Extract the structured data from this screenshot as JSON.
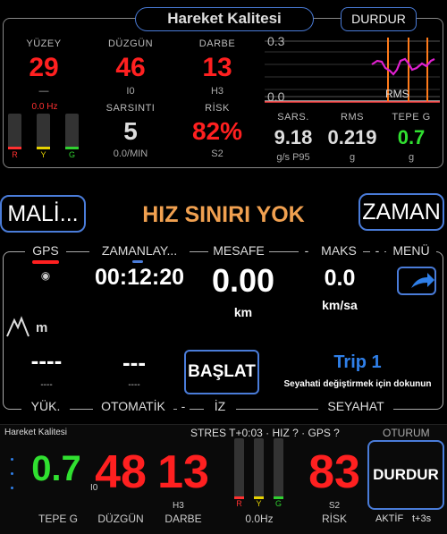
{
  "header": {
    "title": "Hareket Kalitesi",
    "stop_label": "DURDUR"
  },
  "metrics": [
    {
      "label": "YÜZEY",
      "value": "29",
      "sub": "—",
      "color": "#ff2020"
    },
    {
      "label": "DÜZGÜN",
      "value": "46",
      "sub": "I0",
      "color": "#ff2020"
    },
    {
      "label": "DARBE",
      "value": "13",
      "sub": "H3",
      "color": "#ff2020"
    }
  ],
  "metrics_row2": [
    {
      "label": "SARSINTI",
      "value": "5",
      "sub": "0.0/MIN",
      "color": "#dddddd"
    },
    {
      "label": "RİSK",
      "value": "82%",
      "sub": "S2",
      "color": "#ff2020"
    }
  ],
  "freq_label": "0.0 Hz",
  "meters": [
    {
      "label": "R",
      "color": "#ff3030",
      "level": 0.05
    },
    {
      "label": "Y",
      "color": "#e6d200",
      "level": 0.05
    },
    {
      "label": "G",
      "color": "#30d030",
      "level": 0.05
    }
  ],
  "graph": {
    "y_top": "0.3",
    "y_bottom": "0.0",
    "label": "RMS"
  },
  "stats": [
    {
      "label": "SARS.",
      "value": "9.18",
      "unit": "g/s P95",
      "color": "#dddddd"
    },
    {
      "label": "RMS",
      "value": "0.219",
      "unit": "g",
      "color": "#dddddd"
    },
    {
      "label": "TEPE G",
      "value": "0.7",
      "unit": "g",
      "color": "#30e030"
    }
  ],
  "nav": {
    "left_label": "MALİ...",
    "right_label": "ZAMAN",
    "speed_limit": "HIZ SINIRI YOK"
  },
  "tabs": {
    "gps": "GPS",
    "zaman": "ZAMANLAY...",
    "mesafe": "MESAFE",
    "maks": "MAKS",
    "menu": "MENÜ"
  },
  "trip": {
    "time": "00:12:20",
    "distance": "0.00",
    "distance_unit": "km",
    "max": "0.0",
    "max_unit": "km/sa",
    "alt_unit": "m",
    "alt_value": "----",
    "alt_sub": "----",
    "auto_value": "---",
    "auto_sub": "----",
    "start_label": "BAŞLAT",
    "trip_name": "Trip 1",
    "trip_hint": "Seyahati değiştirmek için dokunun"
  },
  "bottom_tabs": {
    "yuk": "YÜK.",
    "oto": "OTOMATİK",
    "iz": "İZ",
    "sey": "SEYAHAT"
  },
  "footer": {
    "title": "Hareket Kalitesi",
    "status": "STRES T+0:03 · HIZ ? · GPS ?",
    "session": "OTURUM",
    "peak": "0.7",
    "peak_label": "TEPE G",
    "smooth": "48",
    "smooth_sub": "I0",
    "smooth_label": "DÜZGÜN",
    "impact": "13",
    "impact_sub": "H3",
    "impact_label": "DARBE",
    "hz": "0.0Hz",
    "risk": "83",
    "risk_sub": "S2",
    "risk_label": "RİSK",
    "stop_label": "DURDUR",
    "active": "AKTİF",
    "active_time": "t+3s"
  }
}
